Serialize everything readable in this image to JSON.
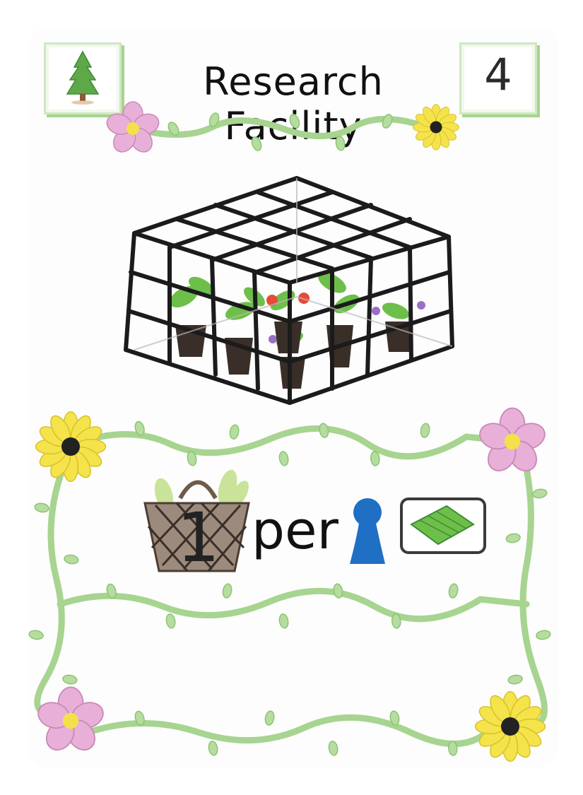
{
  "card": {
    "title": "Research Facility",
    "cost": "4",
    "category_icon": "pine-tree-icon",
    "illustration": "greenhouse-with-potted-plants",
    "ability": {
      "reward_icon": "harvest-basket-icon",
      "reward_amount": "1",
      "connector": "per",
      "worker_icon": "blue-worker-meeple-icon",
      "card_icon": "green-card-icon"
    }
  },
  "colors": {
    "vine": "#9ccf86",
    "leaf": "#a9d692",
    "pink_flower": "#e3a6d2",
    "yellow_flower": "#f3e14a",
    "worker": "#1f6fc4",
    "frame": "#1b1b1b"
  }
}
